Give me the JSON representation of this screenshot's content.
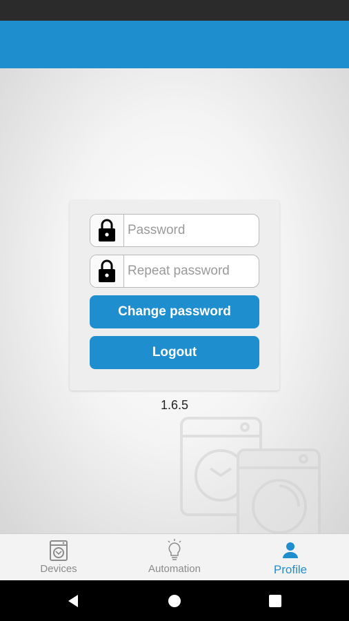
{
  "form": {
    "password_placeholder": "Password",
    "repeat_password_placeholder": "Repeat password",
    "change_password_label": "Change password",
    "logout_label": "Logout"
  },
  "version": "1.6.5",
  "tabs": [
    {
      "label": "Devices",
      "icon": "washing-machine-icon",
      "active": false
    },
    {
      "label": "Automation",
      "icon": "lightbulb-icon",
      "active": false
    },
    {
      "label": "Profile",
      "icon": "person-icon",
      "active": true
    }
  ],
  "colors": {
    "accent": "#1e8ecf",
    "status_bar": "#2b2b2b",
    "inactive_tab": "#8a8a8a"
  }
}
